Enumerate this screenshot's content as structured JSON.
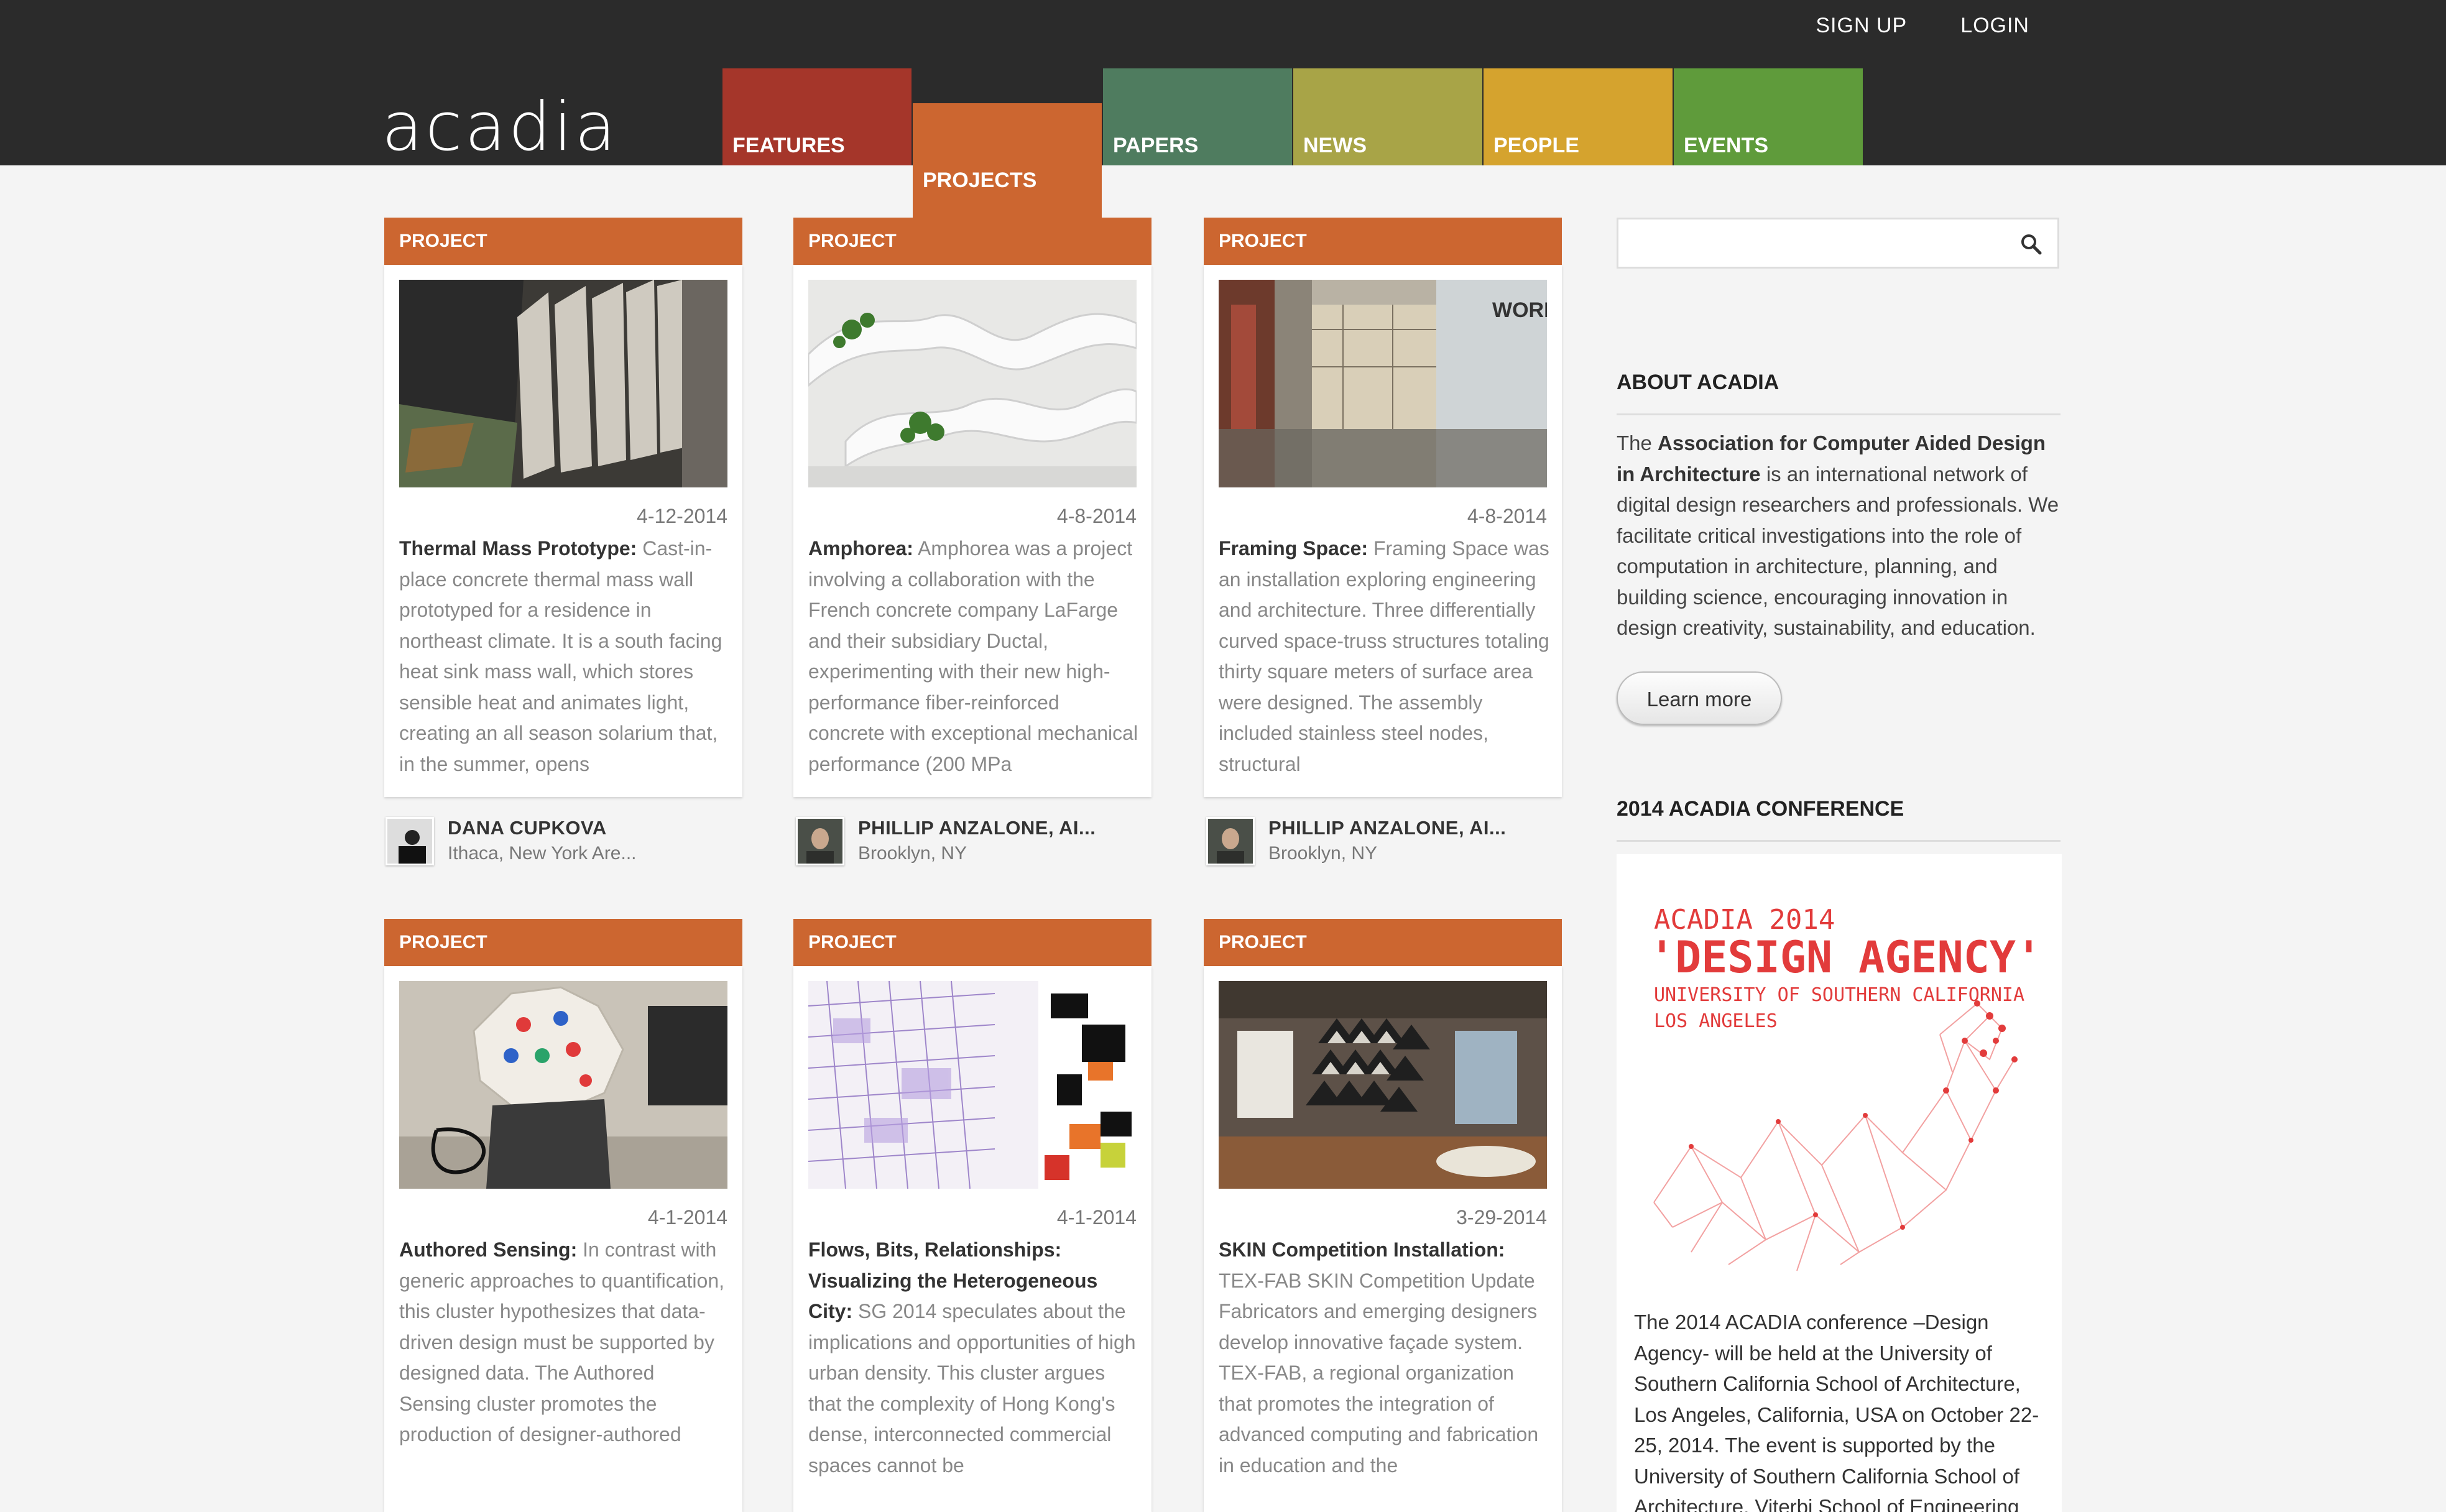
{
  "header": {
    "signup": "SIGN UP",
    "login": "LOGIN",
    "logo": "acadia"
  },
  "nav": [
    {
      "label": "FEATURES",
      "color": "#a5362a"
    },
    {
      "label": "PROJECTS",
      "color": "#cc6630"
    },
    {
      "label": "PAPERS",
      "color": "#4f7c5f"
    },
    {
      "label": "NEWS",
      "color": "#a8a447"
    },
    {
      "label": "PEOPLE",
      "color": "#d5a32e"
    },
    {
      "label": "EVENTS",
      "color": "#5f9b3b"
    }
  ],
  "cards": [
    {
      "tag": "PROJECT",
      "date": "4-12-2014",
      "title": "Thermal Mass Prototype:",
      "text": "Cast-in-place concrete thermal mass wall prototyped for a residence in northeast climate. It is a south facing heat sink mass wall, which stores sensible heat and animates light, creating an all season solarium that, in the summer, opens",
      "author": "DANA CUPKOVA",
      "location": "Ithaca, New York Are..."
    },
    {
      "tag": "PROJECT",
      "date": "4-8-2014",
      "title": "Amphorea:",
      "text": "Amphorea was a project involving a collaboration with the French concrete company LaFarge and their subsidiary Ductal, experimenting with their new high-performance fiber-reinforced concrete with exceptional mechanical performance (200 MPa",
      "author": "PHILLIP ANZALONE, AI...",
      "location": "Brooklyn, NY"
    },
    {
      "tag": "PROJECT",
      "date": "4-8-2014",
      "title": "Framing Space:",
      "text": "Framing Space was an installation exploring engineering and architecture. Three differentially curved space-truss structures totaling thirty square meters of surface area were designed. The assembly included stainless steel nodes, structural",
      "author": "PHILLIP ANZALONE, AI...",
      "location": "Brooklyn, NY"
    },
    {
      "tag": "PROJECT",
      "date": "4-1-2014",
      "title": "Authored Sensing:",
      "text": "In contrast with generic approaches to quantification, this cluster hypothesizes that data-driven design must be supported by designed data. The Authored Sensing cluster promotes the production of designer-authored"
    },
    {
      "tag": "PROJECT",
      "date": "4-1-2014",
      "title": "Flows, Bits, Relationships: Visualizing the Heterogeneous City:",
      "text": "SG 2014 speculates about the implications and opportunities of high urban density. This cluster argues that the complexity of Hong Kong's dense, interconnected commercial spaces cannot be"
    },
    {
      "tag": "PROJECT",
      "date": "3-29-2014",
      "title": "SKIN Competition Installation:",
      "text": "TEX-FAB SKIN Competition Update Fabricators and emerging designers develop innovative façade system. TEX-FAB, a regional organization that promotes the integration of advanced computing and fabrication in education and the"
    }
  ],
  "sidebar": {
    "search_placeholder": "",
    "about_heading": "ABOUT ACADIA",
    "about_pre": "The ",
    "about_bold": "Association for Computer Aided Design in Architecture",
    "about_post": " is an international network of digital design researchers and professionals. We facilitate critical investigations into the role of computation in architecture, planning, and building science, encouraging innovation in design creativity, sustainability, and education.",
    "learn_more": "Learn more",
    "conf_heading": "2014 ACADIA CONFERENCE",
    "poster_line1": "ACADIA 2014",
    "poster_line2": "'DESIGN AGENCY'",
    "poster_line3": "UNIVERSITY OF SOUTHERN CALIFORNIA",
    "poster_line4": "LOS ANGELES",
    "conf_text": "The 2014 ACADIA conference –Design Agency- will be held at the University of Southern California School of Architecture, Los Angeles, California, USA on October 22-25, 2014. The event is supported by the University of Southern California School of Architecture, Viterbi School of Engineering"
  }
}
